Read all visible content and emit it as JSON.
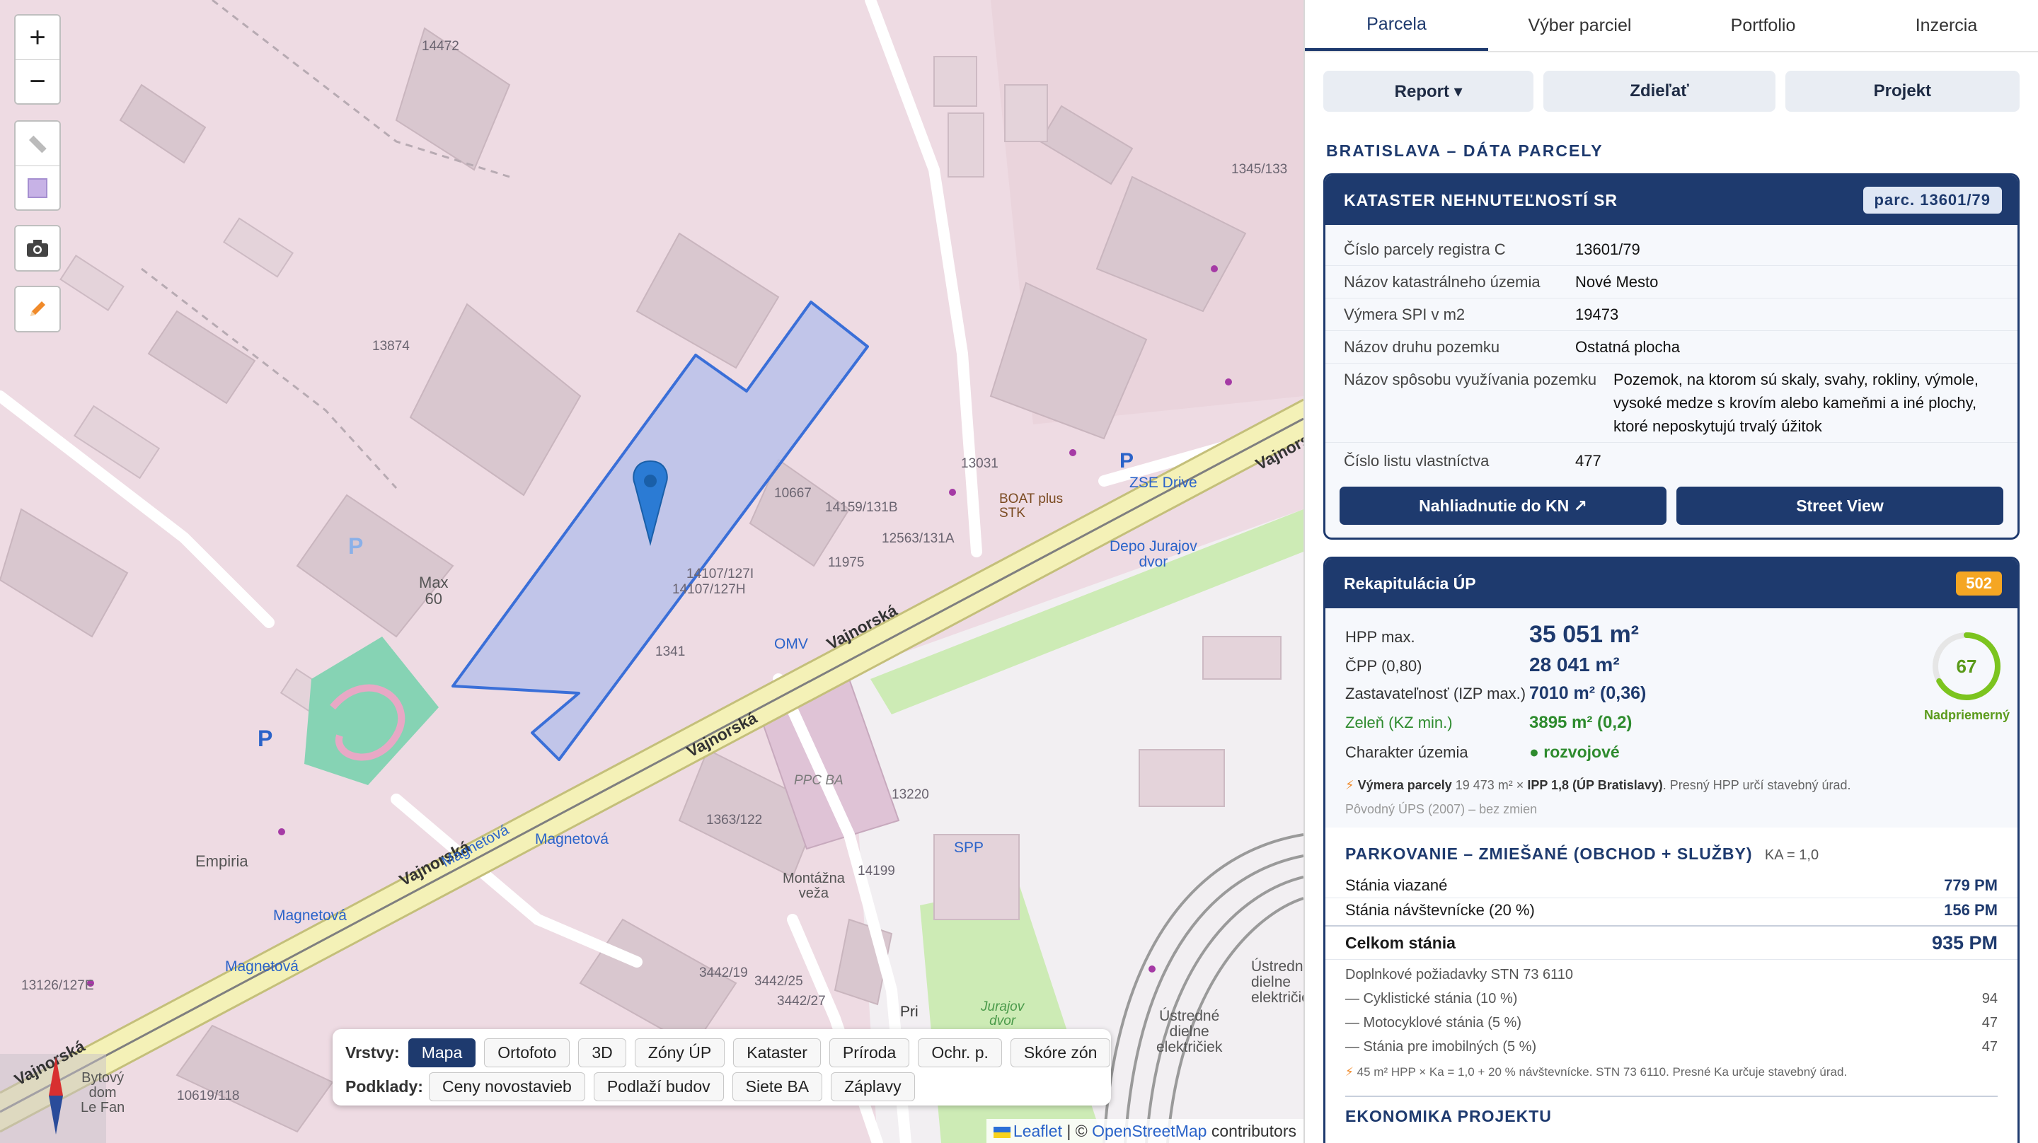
{
  "map": {
    "labels": {
      "n14472": "14472",
      "n13874": "13874",
      "n1345": "1345/133",
      "n13031": "13031",
      "n10667": "10667",
      "n14159": "14159/131B",
      "n12563": "12563/131A",
      "n11975": "11975",
      "n14107a": "14107/127I",
      "n14107b": "14107/127H",
      "n1341": "1341",
      "max60": "Max\n60",
      "empiria": "Empiria",
      "boat": "BOAT plus\nSTK",
      "zse": "ZSE Drive",
      "depo": "Depo Jurajov\ndvor",
      "omv": "OMV",
      "vajnorska": "Vajnorská",
      "ppcba": "PPC BA",
      "n1363": "1363/122",
      "n13220": "13220",
      "n14199": "14199",
      "montazna": "Montážna\nveža",
      "magnetova": "Magnetová",
      "n3442_19": "3442/19",
      "n3442_25": "3442/25",
      "n3442_27": "3442/27",
      "n13126": "13126/127E",
      "n10619": "10619/118",
      "bytovy": "Bytový\ndom\nLe Fan",
      "jurajov": "Jurajov\ndvor",
      "ustredne": "Ústredné\ndielne\nelektričiek",
      "spp": "SPP",
      "pri": "Pri",
      "p": "P"
    },
    "controls": {
      "zoom_in": "+",
      "zoom_out": "−"
    },
    "layers": {
      "row1_label": "Vrstvy:",
      "row1": [
        "Mapa",
        "Ortofoto",
        "3D",
        "Zóny ÚP",
        "Kataster",
        "Príroda",
        "Ochr. p.",
        "Skóre zón"
      ],
      "row1_active": "Mapa",
      "row2_label": "Podklady:",
      "row2": [
        "Ceny novostavieb",
        "Podlaží budov",
        "Siete BA",
        "Záplavy"
      ]
    },
    "attribution": {
      "leaflet": "Leaflet",
      "sep": " | © ",
      "osm": "OpenStreetMap",
      "tail": " contributors"
    }
  },
  "panel": {
    "tabs": [
      "Parcela",
      "Výber parciel",
      "Portfolio",
      "Inzercia"
    ],
    "active_tab": "Parcela",
    "actions": {
      "report": "Report ▾",
      "share": "Zdieľať",
      "project": "Projekt"
    },
    "section_title": "BRATISLAVA – DÁTA PARCELY",
    "kataster": {
      "title": "KATASTER NEHNUTEĽNOSTÍ SR",
      "badge": "parc. 13601/79",
      "rows": [
        {
          "k": "Číslo parcely registra C",
          "v": "13601/79"
        },
        {
          "k": "Názov katastrálneho územia",
          "v": "Nové Mesto"
        },
        {
          "k": "Výmera SPI v m2",
          "v": "19473"
        },
        {
          "k": "Názov druhu pozemku",
          "v": "Ostatná plocha"
        },
        {
          "k": "Názov spôsobu využívania pozemku",
          "v": "Pozemok, na ktorom sú skaly, svahy, rokliny, výmole, vysoké medze s krovím alebo kameňmi a iné plochy, ktoré neposkytujú trvalý úžitok"
        },
        {
          "k": "Číslo listu vlastníctva",
          "v": "477"
        }
      ],
      "btn_kn": "Nahliadnutie do KN ↗",
      "btn_sv": "Street View"
    },
    "up": {
      "title": "Rekapitulácia ÚP",
      "badge": "502",
      "hpp_k": "HPP max.",
      "hpp_v": "35 051 m²",
      "cpp_k": "ČPP (0,80)",
      "cpp_v": "28 041 m²",
      "zast_k": "Zastavateľnosť (IZP max.)",
      "zast_v": "7010 m² (0,36)",
      "zelen_k": "Zeleň (KZ min.)",
      "zelen_v": "3895 m² (0,2)",
      "char_k": "Charakter územia",
      "char_v": "● rozvojové",
      "note1_bold": "Výmera parcely",
      "note1_mid": " 19 473 m² × ",
      "note1_bold2": "IPP 1,8 (ÚP Bratislavy)",
      "note1_tail": ". Presný HPP určí stavebný úrad.",
      "note2": "Pôvodný ÚPS (2007) – bez zmien",
      "score": 67,
      "score_label": "Nadpriemerný",
      "score_color": "#7cc41f"
    },
    "parking": {
      "title": "PARKOVANIE – ZMIEŠANÉ (OBCHOD + SLUŽBY)",
      "ka": "KA = 1,0",
      "rows": [
        {
          "k": "Stánia viazané",
          "v": "779 PM"
        },
        {
          "k": "Stánia návštevnícke (20 %)",
          "v": "156 PM"
        }
      ],
      "total_k": "Celkom stánia",
      "total_v": "935 PM",
      "extra_title": "Doplnkové požiadavky STN 73 6110",
      "extra": [
        {
          "k": "— Cyklistické stánia (10 %)",
          "v": "94"
        },
        {
          "k": "— Motocyklové stánia (5 %)",
          "v": "47"
        },
        {
          "k": "— Stánia pre imobilných (5 %)",
          "v": "47"
        }
      ],
      "note": "45 m² HPP × Ka = 1,0 + 20 % návštevnícke. STN 73 6110. Presné Ka určuje stavebný úrad."
    },
    "next_section": "EKONOMIKA PROJEKTU"
  }
}
